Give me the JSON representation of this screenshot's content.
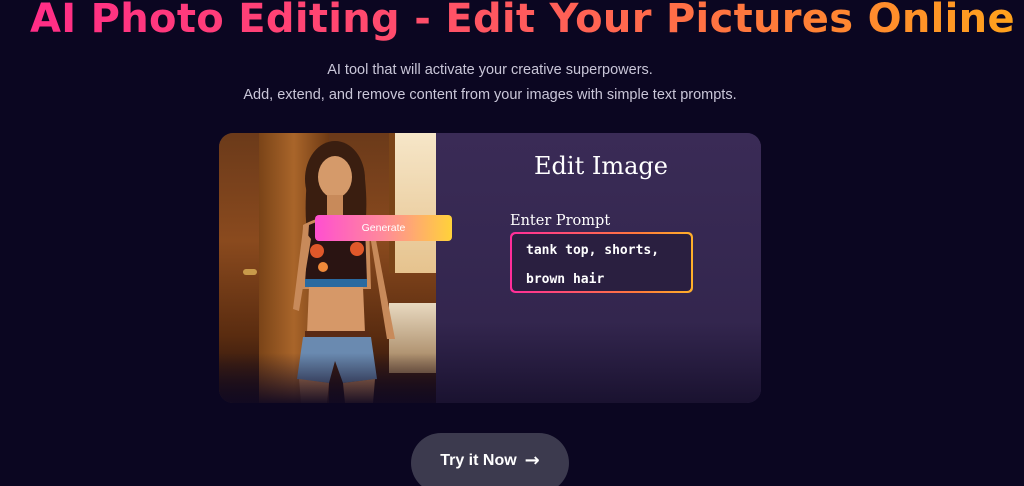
{
  "hero": {
    "title": "AI Photo Editing - Edit Your Pictures Online",
    "subtitle_line1": "AI tool that will activate your creative superpowers.",
    "subtitle_line2": "Add, extend, and remove content from your images with simple text prompts."
  },
  "demo": {
    "panel_title": "Edit Image",
    "prompt_label": "Enter Prompt",
    "prompt_value": "tank top, shorts,\nbrown hair",
    "generate_label": "Generate"
  },
  "cta": {
    "label": "Try it Now",
    "icon": "arrow-right-icon"
  },
  "colors": {
    "background": "#0b0621",
    "title_gradient_start": "#ff2d87",
    "title_gradient_end": "#ffa21c",
    "panel": "#33264e",
    "cta_button": "#3c3a4e"
  }
}
